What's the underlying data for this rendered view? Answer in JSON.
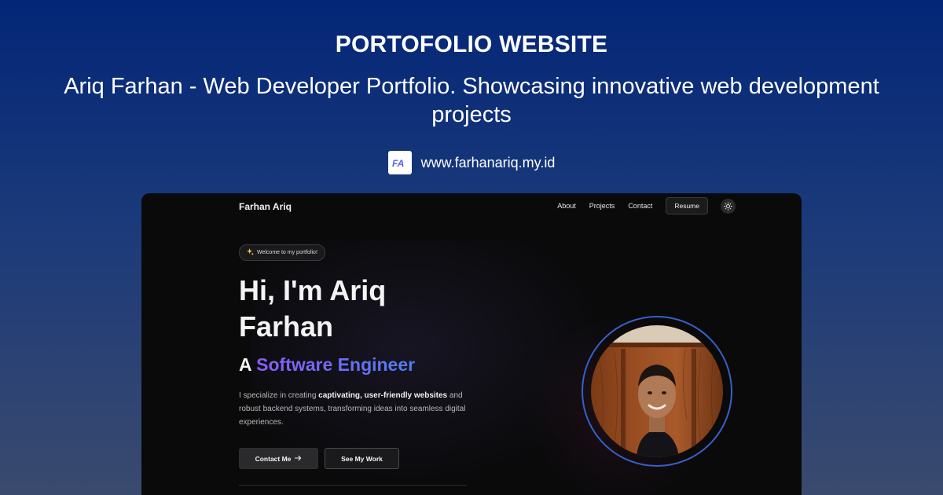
{
  "card": {
    "title": "PORTOFOLIO WEBSITE",
    "subtitle": "Ariq Farhan - Web Developer Portfolio. Showcasing innovative web development projects",
    "site_url": "www.farhanariq.my.id",
    "favicon_text": "FA"
  },
  "site": {
    "brand": "Farhan Ariq",
    "nav": [
      {
        "label": "About"
      },
      {
        "label": "Projects"
      },
      {
        "label": "Contact"
      }
    ],
    "resume_label": "Resume",
    "badge_text": "Welcome to my portfolio!",
    "hero_line1": "Hi, I'm Ariq",
    "hero_line2": "Farhan",
    "role_prefix": "A ",
    "role_highlight": "Software Engineer",
    "description_part1": "I specialize in creating ",
    "description_bold": "captivating, user-friendly websites",
    "description_part2": " and robust backend systems, transforming ideas into seamless digital experiences.",
    "contact_button": "Contact Me",
    "work_button": "See My Work"
  },
  "colors": {
    "background_top": "#032677",
    "background_bottom": "#3a4a6e",
    "frame_bg": "#0a0a0b",
    "accent_purple": "#8b5cf6",
    "accent_blue": "#4f7df0",
    "ring": "#3760c7"
  },
  "icons": {
    "favicon": "fa-logo-icon",
    "theme_toggle": "sun-icon",
    "badge": "sparkle-icon",
    "contact_arrow": "arrow-right-icon"
  }
}
